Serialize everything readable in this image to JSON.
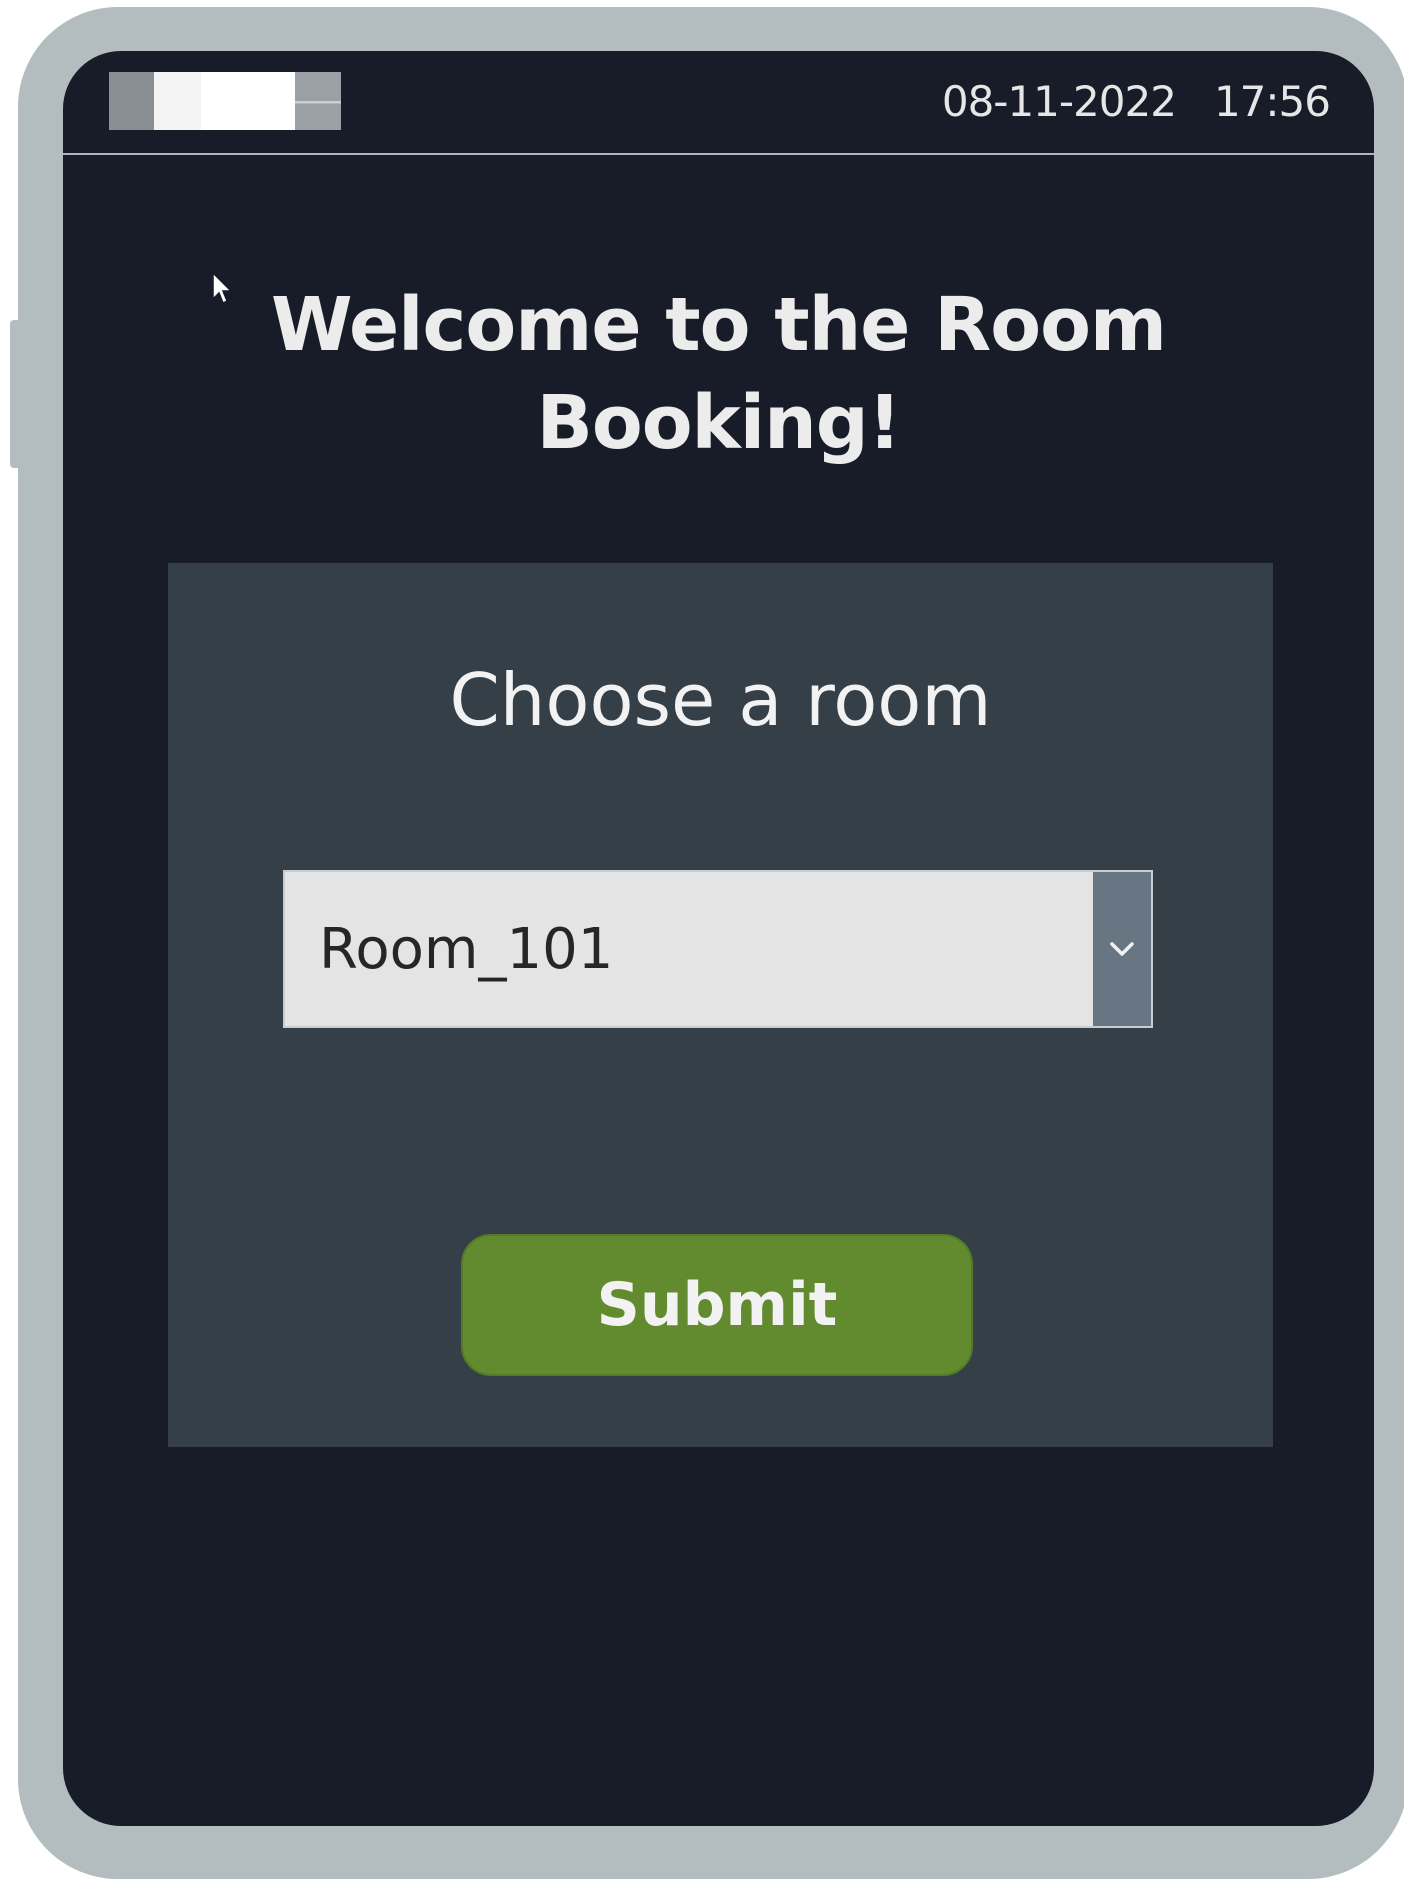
{
  "status_bar": {
    "date": "08-11-2022",
    "time": "17:56"
  },
  "welcome": {
    "line1": "Welcome to the Room",
    "line2": "Booking!"
  },
  "booking_form": {
    "title": "Choose a room",
    "room_select": {
      "selected": "Room_101"
    },
    "submit_label": "Submit"
  },
  "colors": {
    "screen_background": "#171c28",
    "card_background": "#343f48",
    "submit_button": "#628a2e",
    "device_frame": "#b3bcbf"
  },
  "icons": {
    "cursor": "cursor-icon",
    "dropdown": "chevron-down-icon",
    "logo": "logo"
  }
}
